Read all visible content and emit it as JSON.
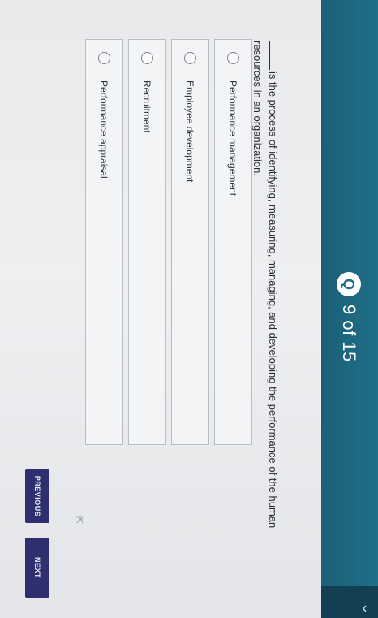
{
  "header": {
    "counter_icon": "Q",
    "counter_text": "9 of 15"
  },
  "question": {
    "text": "is the process of identifying, measuring, managing, and developing the performance of the human resources in an organization."
  },
  "options": [
    {
      "label": "Performance management"
    },
    {
      "label": "Employee development"
    },
    {
      "label": "Recruitment"
    },
    {
      "label": "Performance appraisal"
    }
  ],
  "navigation": {
    "previous_label": "PREVIOUS",
    "next_label": "NEXT"
  },
  "colors": {
    "header": "#1f6f86",
    "button": "#2e2f6e"
  }
}
